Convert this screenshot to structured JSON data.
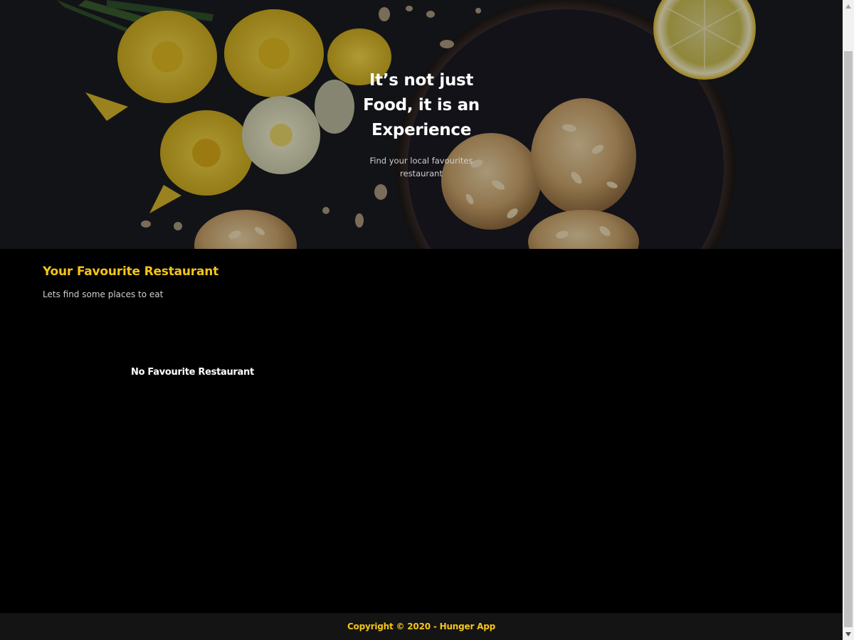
{
  "hero": {
    "title_line1": "It’s not just",
    "title_line2": "Food, it is an",
    "title_line3": "Experience",
    "subtitle": "Find your local favourites restaurant"
  },
  "favourites": {
    "title": "Your Favourite Restaurant",
    "subtitle": "Lets find some places to eat",
    "empty_message": "No Favourite Restaurant"
  },
  "footer": {
    "copyright": "Copyright © 2020 - Hunger App"
  },
  "colors": {
    "accent": "#f5c518",
    "background": "#000000",
    "footer_bg": "#141414"
  },
  "icons": {
    "scroll_up": "scroll-up-arrow-icon",
    "scroll_down": "scroll-down-arrow-icon"
  }
}
